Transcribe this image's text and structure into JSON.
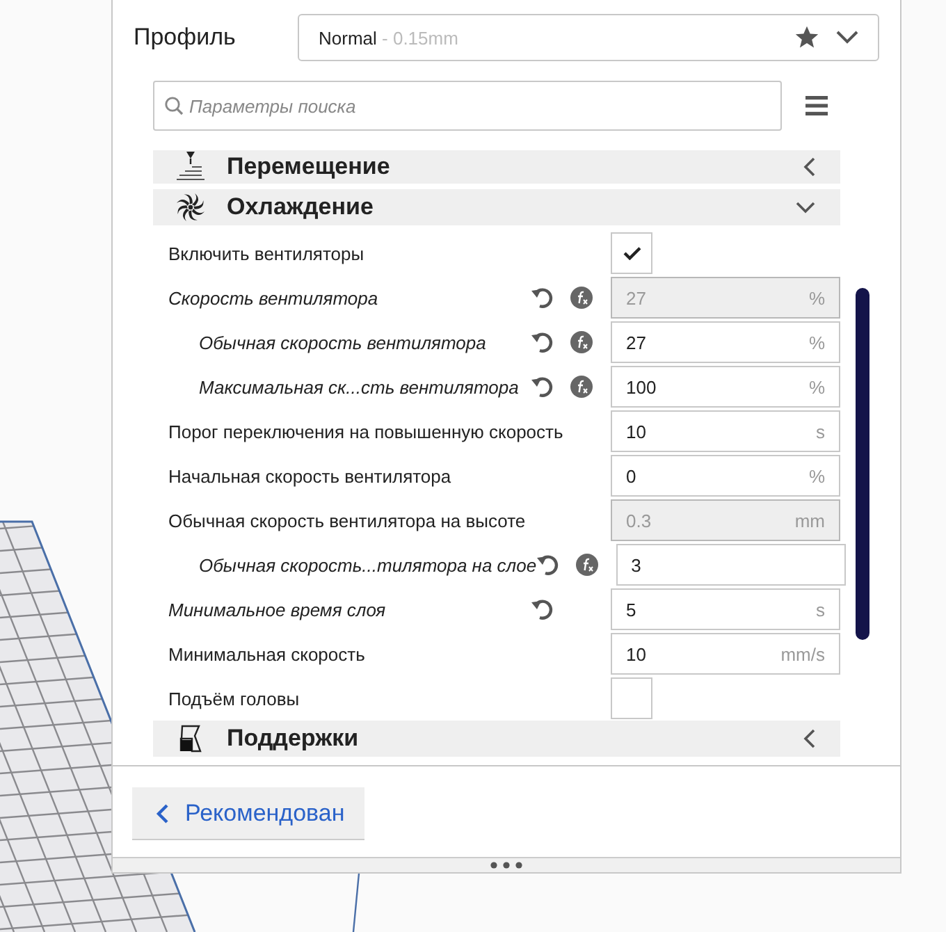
{
  "profile": {
    "label": "Профиль",
    "name": "Normal",
    "detail": " - 0.15mm"
  },
  "search": {
    "placeholder": "Параметры поиска"
  },
  "categories": [
    {
      "title": "Перемещение",
      "kind": "travel",
      "expanded": false
    },
    {
      "title": "Охлаждение",
      "kind": "cooling",
      "expanded": true,
      "settings": [
        {
          "kind": "checkbox",
          "label": "Включить вентиляторы",
          "checked": true,
          "modified": false,
          "reset": false,
          "formula": false
        },
        {
          "kind": "field",
          "label": "Скорость вентилятора",
          "value": "27",
          "unit": "%",
          "disabled": true,
          "modified": true,
          "reset": true,
          "formula": true,
          "children": [
            {
              "kind": "field",
              "label": "Обычная скорость вентилятора",
              "value": "27",
              "unit": "%",
              "disabled": false,
              "modified": true,
              "reset": true,
              "formula": true
            },
            {
              "kind": "field",
              "label": "Максимальная ск...сть вентилятора",
              "value": "100",
              "unit": "%",
              "disabled": false,
              "modified": true,
              "reset": true,
              "formula": true
            }
          ]
        },
        {
          "kind": "field",
          "label": "Порог переключения на повышенную скорость",
          "value": "10",
          "unit": "s",
          "disabled": false,
          "modified": false,
          "reset": false,
          "formula": false
        },
        {
          "kind": "field",
          "label": "Начальная скорость вентилятора",
          "value": "0",
          "unit": "%",
          "disabled": false,
          "modified": false,
          "reset": false,
          "formula": false
        },
        {
          "kind": "field",
          "label": "Обычная скорость вентилятора на высоте",
          "value": "0.3",
          "unit": "mm",
          "disabled": true,
          "modified": false,
          "reset": false,
          "formula": false,
          "children": [
            {
              "kind": "field",
              "label": "Обычная скорость...тилятора на слое",
              "value": "3",
              "disabled": false,
              "modified": true,
              "reset": true,
              "formula": true
            }
          ]
        },
        {
          "kind": "field",
          "label": "Минимальное время слоя",
          "value": "5",
          "unit": "s",
          "disabled": false,
          "modified": true,
          "reset": true,
          "formula": false
        },
        {
          "kind": "field",
          "label": "Минимальная скорость",
          "value": "10",
          "unit": "mm/s",
          "disabled": false,
          "modified": false,
          "reset": false,
          "formula": false
        },
        {
          "kind": "checkbox",
          "label": "Подъём головы",
          "checked": false,
          "modified": false,
          "reset": false,
          "formula": false
        }
      ]
    },
    {
      "title": "Поддержки",
      "kind": "support",
      "expanded": false
    }
  ],
  "back_button": {
    "label": "Рекомендован"
  }
}
